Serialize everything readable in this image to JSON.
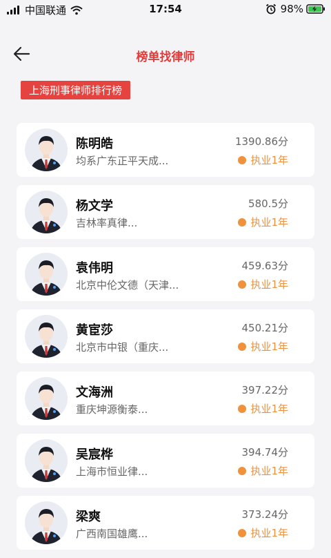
{
  "status": {
    "carrier": "中国联通",
    "time": "17:54",
    "battery": "98%",
    "icons": [
      "signal-icon",
      "wifi-icon",
      "alarm-icon",
      "battery-charging-icon"
    ]
  },
  "nav": {
    "title": "榜单找律师",
    "back_icon": "back-arrow-icon"
  },
  "rank_title": "上海刑事律师排行榜",
  "lawyers": [
    {
      "name": "陈明皓",
      "firm": "均系广东正平天成...",
      "score": "1390.86分",
      "experience": "执业1年"
    },
    {
      "name": "杨文学",
      "firm": "吉林率真律...",
      "score": "580.5分",
      "experience": "执业1年"
    },
    {
      "name": "袁伟明",
      "firm": "北京中伦文德（天津...",
      "score": "459.63分",
      "experience": "执业1年"
    },
    {
      "name": "黄宦莎",
      "firm": "北京市中银（重庆...",
      "score": "450.21分",
      "experience": "执业1年"
    },
    {
      "name": "文海洲",
      "firm": "重庆坤源衡泰...",
      "score": "397.22分",
      "experience": "执业1年"
    },
    {
      "name": "吴宸桦",
      "firm": "上海市恒业律...",
      "score": "394.74分",
      "experience": "执业1年"
    },
    {
      "name": "梁爽",
      "firm": "广西南国雄鹰...",
      "score": "373.24分",
      "experience": "执业1年"
    }
  ],
  "colors": {
    "accent": "#e5433f",
    "experience": "#f0913c"
  }
}
